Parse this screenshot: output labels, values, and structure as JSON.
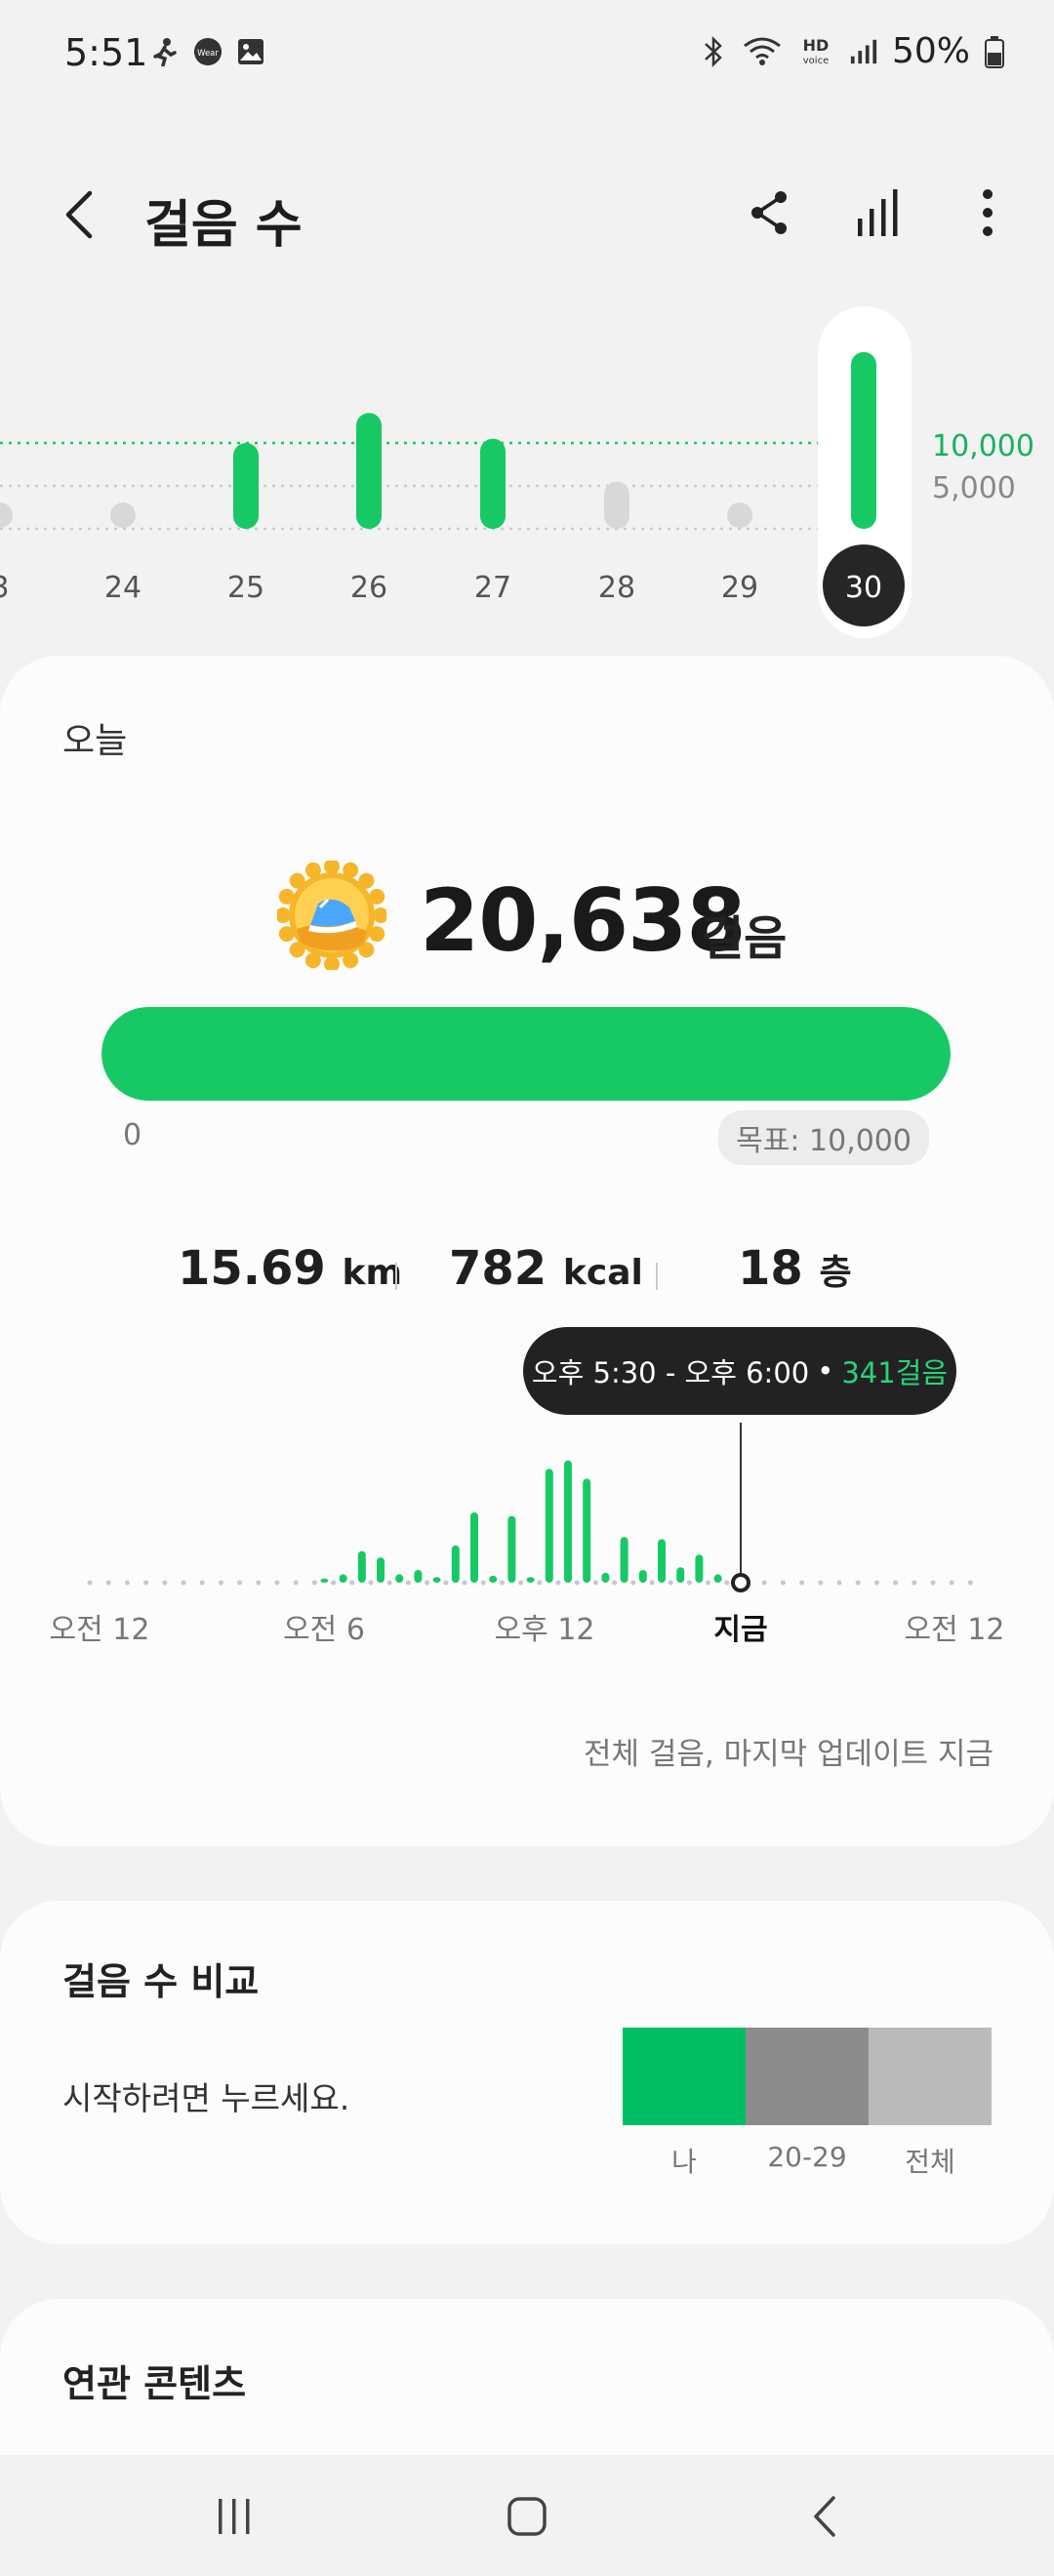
{
  "status_bar": {
    "time": "5:51",
    "left_icons": [
      "pedestrian-icon",
      "wear-icon",
      "gallery-icon"
    ],
    "right_icons": [
      "bluetooth-icon",
      "wifi-icon",
      "hd-voice-icon",
      "signal-icon",
      "battery-icon"
    ],
    "battery": "50%",
    "wear_text": "Wear",
    "hd_text": "HD",
    "voice_text": "voice"
  },
  "app_bar": {
    "title": "걸음 수",
    "actions": [
      "share-icon",
      "bar-chart-icon",
      "more-icon"
    ]
  },
  "week_chart": {
    "days": [
      "3",
      "24",
      "25",
      "26",
      "27",
      "28",
      "29",
      "30"
    ],
    "selected_day": "30",
    "goal_label": "10,000",
    "mid_label": "5,000",
    "bars": [
      {
        "day": "3",
        "fraction": 0.0,
        "reached": false
      },
      {
        "day": "24",
        "fraction": 0.0,
        "reached": false
      },
      {
        "day": "25",
        "fraction": 1.0,
        "reached": true
      },
      {
        "day": "26",
        "fraction": 1.35,
        "reached": true
      },
      {
        "day": "27",
        "fraction": 1.05,
        "reached": true
      },
      {
        "day": "28",
        "fraction": 0.55,
        "reached": false
      },
      {
        "day": "29",
        "fraction": 0.0,
        "reached": false
      },
      {
        "day": "30",
        "fraction": 2.06,
        "reached": true
      }
    ],
    "colors": {
      "reached": "#17c964",
      "missed": "#d8d8d8",
      "selected_bg": "#262626"
    }
  },
  "today": {
    "label": "오늘",
    "steps": "20,638",
    "unit": "걸음",
    "progress_fraction": 1.0,
    "zero": "0",
    "goal": "목표: 10,000",
    "stats": {
      "distance": "15.69",
      "distance_unit": "km",
      "calories": "782",
      "calories_unit": "kcal",
      "floors": "18",
      "floors_unit": "층"
    },
    "tooltip": {
      "range": "오후 5:30 - 오후 6:00",
      "dot": "•",
      "value": "341걸음"
    },
    "hour_axis": [
      "오전 12",
      "오전 6",
      "오후 12",
      "지금",
      "오전 12"
    ],
    "update_note": "전체 걸음, 마지막 업데이트 지금",
    "chart_data": {
      "type": "bar",
      "title": "",
      "xlabel": "",
      "ylabel": "",
      "x": [
        12,
        13,
        14,
        15,
        16,
        17,
        18,
        19,
        20,
        21,
        22,
        23,
        24,
        25,
        26,
        27,
        28,
        29,
        30,
        31,
        32,
        33,
        34,
        35
      ],
      "values": [
        0.06,
        0.12,
        0.45,
        0.36,
        0.12,
        0.18,
        0.08,
        0.53,
        1.0,
        0.1,
        0.95,
        0.08,
        1.62,
        1.74,
        1.48,
        0.14,
        0.65,
        0.18,
        0.62,
        0.22,
        0.4,
        0.12,
        0,
        0
      ],
      "color": "#17c964",
      "now_index": 21
    }
  },
  "compare": {
    "title": "걸음 수 비교",
    "hint": "시작하려면 누르세요.",
    "bars": [
      {
        "label": "나",
        "color": "#00be64"
      },
      {
        "label": "20-29",
        "color": "#8c8c8c"
      },
      {
        "label": "전체",
        "color": "#bababa"
      }
    ]
  },
  "related": {
    "title": "연관 콘텐츠"
  },
  "nav": [
    "recents-icon",
    "home-icon",
    "back-icon"
  ]
}
